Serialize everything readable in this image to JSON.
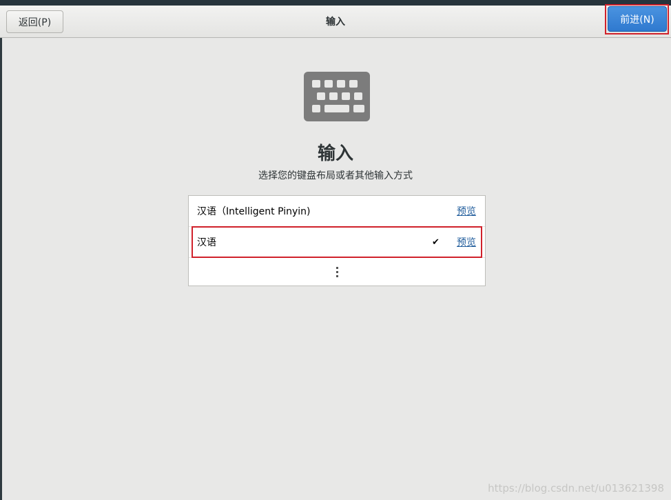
{
  "header": {
    "back_label": "返回(P)",
    "title": "输入",
    "next_label": "前进(N)"
  },
  "main": {
    "icon": "keyboard-icon",
    "heading": "输入",
    "subtitle": "选择您的键盘布局或者其他输入方式",
    "input_sources": [
      {
        "label": "汉语（Intelligent Pinyin)",
        "preview_label": "预览",
        "selected": false
      },
      {
        "label": "汉语",
        "preview_label": "预览",
        "selected": true
      }
    ],
    "more_icon": "vertical-ellipsis-icon"
  },
  "watermark": "https://blog.csdn.net/u013621398",
  "colors": {
    "accent": "#3584e4",
    "highlight": "#d0202a",
    "link": "#215d9c",
    "background": "#e8e8e7"
  }
}
